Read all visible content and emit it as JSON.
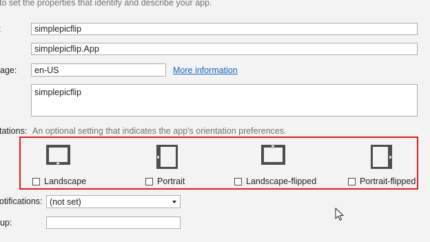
{
  "intro_text": "to set the properties that identify and describe your app.",
  "fields": {
    "display_name": {
      "label": ":",
      "value": "simplepicflip"
    },
    "entry_point": {
      "value": "simplepicflip.App"
    },
    "language": {
      "label": "age:",
      "value": "en-US",
      "link": "More information"
    },
    "description": {
      "value": "simplepicflip"
    }
  },
  "orientations": {
    "label": "tations:",
    "hint": "An optional setting that indicates the app's orientation preferences.",
    "items": [
      {
        "label": "Landscape",
        "icon": "landscape-tablet-icon",
        "checked": false
      },
      {
        "label": "Portrait",
        "icon": "portrait-tablet-icon",
        "checked": false
      },
      {
        "label": "Landscape-flipped",
        "icon": "landscape-flipped-tablet-icon",
        "checked": false
      },
      {
        "label": "Portrait-flipped",
        "icon": "portrait-flipped-tablet-icon",
        "checked": false
      }
    ],
    "highlight_color": "#e01b22"
  },
  "notifications": {
    "label": "otifications:",
    "value": "(not set)"
  },
  "lockscreen": {
    "label": "up:",
    "value": ""
  },
  "colors": {
    "link": "#1565c0",
    "hint": "#717171",
    "icon": "#4d4d4d"
  }
}
